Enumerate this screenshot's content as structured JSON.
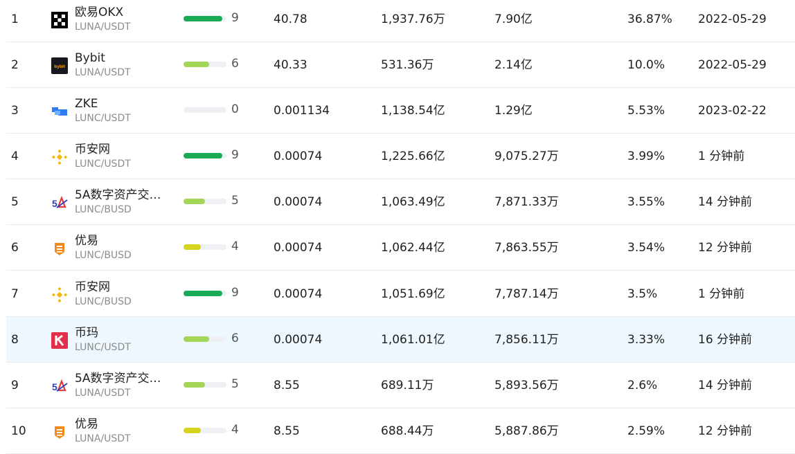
{
  "rows": [
    {
      "rank": "1",
      "exchange": "欧易OKX",
      "logo": "okx-icon",
      "pair": "LUNA/USDT",
      "score": 9,
      "score_color": "#1aaa55",
      "price": "40.78",
      "volume_24h": "1,937.76万",
      "volume_usd": "7.90亿",
      "share": "36.87%",
      "updated": "2022-05-29"
    },
    {
      "rank": "2",
      "exchange": "Bybit",
      "logo": "bybit-icon",
      "pair": "LUNA/USDT",
      "score": 6,
      "score_color": "#a3d557",
      "price": "40.33",
      "volume_24h": "531.36万",
      "volume_usd": "2.14亿",
      "share": "10.0%",
      "updated": "2022-05-29"
    },
    {
      "rank": "3",
      "exchange": "ZKE",
      "logo": "zke-icon",
      "pair": "LUNC/USDT",
      "score": 0,
      "score_color": "#a3d557",
      "price": "0.001134",
      "volume_24h": "1,138.54亿",
      "volume_usd": "1.29亿",
      "share": "5.53%",
      "updated": "2023-02-22"
    },
    {
      "rank": "4",
      "exchange": "币安网",
      "logo": "binance-icon",
      "pair": "LUNC/USDT",
      "score": 9,
      "score_color": "#1aaa55",
      "price": "0.00074",
      "volume_24h": "1,225.66亿",
      "volume_usd": "9,075.27万",
      "share": "3.99%",
      "updated": "1 分钟前"
    },
    {
      "rank": "5",
      "exchange": "5A数字资产交…",
      "logo": "5a-icon",
      "pair": "LUNC/BUSD",
      "score": 5,
      "score_color": "#a3d557",
      "price": "0.00074",
      "volume_24h": "1,063.49亿",
      "volume_usd": "7,871.33万",
      "share": "3.55%",
      "updated": "14 分钟前"
    },
    {
      "rank": "6",
      "exchange": "优易",
      "logo": "youyi-icon",
      "pair": "LUNC/BUSD",
      "score": 4,
      "score_color": "#d6d31f",
      "price": "0.00074",
      "volume_24h": "1,062.44亿",
      "volume_usd": "7,863.55万",
      "share": "3.54%",
      "updated": "12 分钟前"
    },
    {
      "rank": "7",
      "exchange": "币安网",
      "logo": "binance-icon",
      "pair": "LUNC/BUSD",
      "score": 9,
      "score_color": "#1aaa55",
      "price": "0.00074",
      "volume_24h": "1,051.69亿",
      "volume_usd": "7,787.14万",
      "share": "3.5%",
      "updated": "1 分钟前"
    },
    {
      "rank": "8",
      "exchange": "币玛",
      "logo": "bima-icon",
      "pair": "LUNC/USDT",
      "score": 6,
      "score_color": "#a3d557",
      "price": "0.00074",
      "volume_24h": "1,061.01亿",
      "volume_usd": "7,856.11万",
      "share": "3.33%",
      "updated": "16 分钟前"
    },
    {
      "rank": "9",
      "exchange": "5A数字资产交…",
      "logo": "5a-icon",
      "pair": "LUNA/USDT",
      "score": 5,
      "score_color": "#a3d557",
      "price": "8.55",
      "volume_24h": "689.11万",
      "volume_usd": "5,893.56万",
      "share": "2.6%",
      "updated": "14 分钟前"
    },
    {
      "rank": "10",
      "exchange": "优易",
      "logo": "youyi-icon",
      "pair": "LUNA/USDT",
      "score": 4,
      "score_color": "#d6d31f",
      "price": "8.55",
      "volume_24h": "688.44万",
      "volume_usd": "5,887.86万",
      "share": "2.59%",
      "updated": "12 分钟前"
    }
  ]
}
